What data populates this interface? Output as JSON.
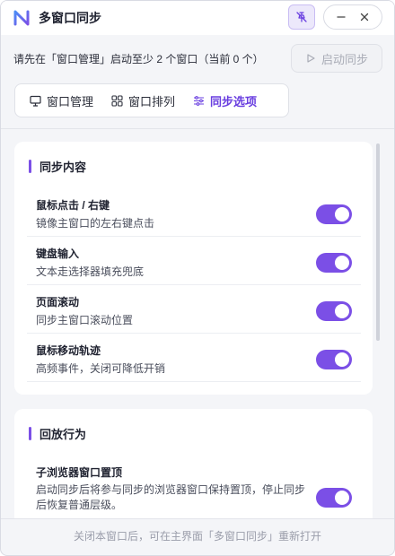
{
  "app": {
    "title": "多窗口同步"
  },
  "notice": {
    "text": "请先在「窗口管理」启动至少 2 个窗口（当前 0 个）"
  },
  "sync_button": {
    "label": "启动同步",
    "enabled": false
  },
  "tabs": [
    {
      "label": "窗口管理",
      "icon": "monitor-icon",
      "active": false
    },
    {
      "label": "窗口排列",
      "icon": "grid-icon",
      "active": false
    },
    {
      "label": "同步选项",
      "icon": "sliders-icon",
      "active": true
    }
  ],
  "sections": [
    {
      "title": "同步内容",
      "items": [
        {
          "title": "鼠标点击 / 右键",
          "desc": "镜像主窗口的左右键点击",
          "enabled": true
        },
        {
          "title": "键盘输入",
          "desc": "文本走选择器填充兜底",
          "enabled": true
        },
        {
          "title": "页面滚动",
          "desc": "同步主窗口滚动位置",
          "enabled": true
        },
        {
          "title": "鼠标移动轨迹",
          "desc": "高频事件，关闭可降低开销",
          "enabled": true
        }
      ]
    },
    {
      "title": "回放行为",
      "items": [
        {
          "title": "子浏览器窗口置顶",
          "desc": "启动同步后将参与同步的浏览器窗口保持置顶，停止同步后恢复普通层级。",
          "enabled": true
        }
      ]
    }
  ],
  "footer": {
    "text": "关闭本窗口后，可在主界面「多窗口同步」重新打开"
  },
  "colors": {
    "accent": "#7b4fe6",
    "accent_text": "#6a3fe0",
    "background": "#f4f5f8"
  }
}
